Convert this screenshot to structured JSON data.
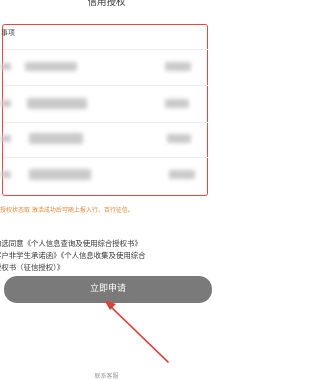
{
  "page": {
    "title": "信用授权"
  },
  "card": {
    "header": "事项"
  },
  "notice": {
    "text": "授权状态取 激活成功后可随上报入行、百行征信。"
  },
  "agreement": {
    "line1": "勾选同意《个人信息查询及使用综合授权书》",
    "line2": "客户非学生承诺函》《个人信息收集及使用综合",
    "line3": "授权书（征信授权）》"
  },
  "actions": {
    "submit_label": "立即申请"
  },
  "footer": {
    "link_label": "联系客服"
  },
  "colors": {
    "card_border": "#e84545",
    "notice_text": "#e08a3a",
    "button_bg": "#7a7a7a",
    "arrow": "#d9423c"
  }
}
